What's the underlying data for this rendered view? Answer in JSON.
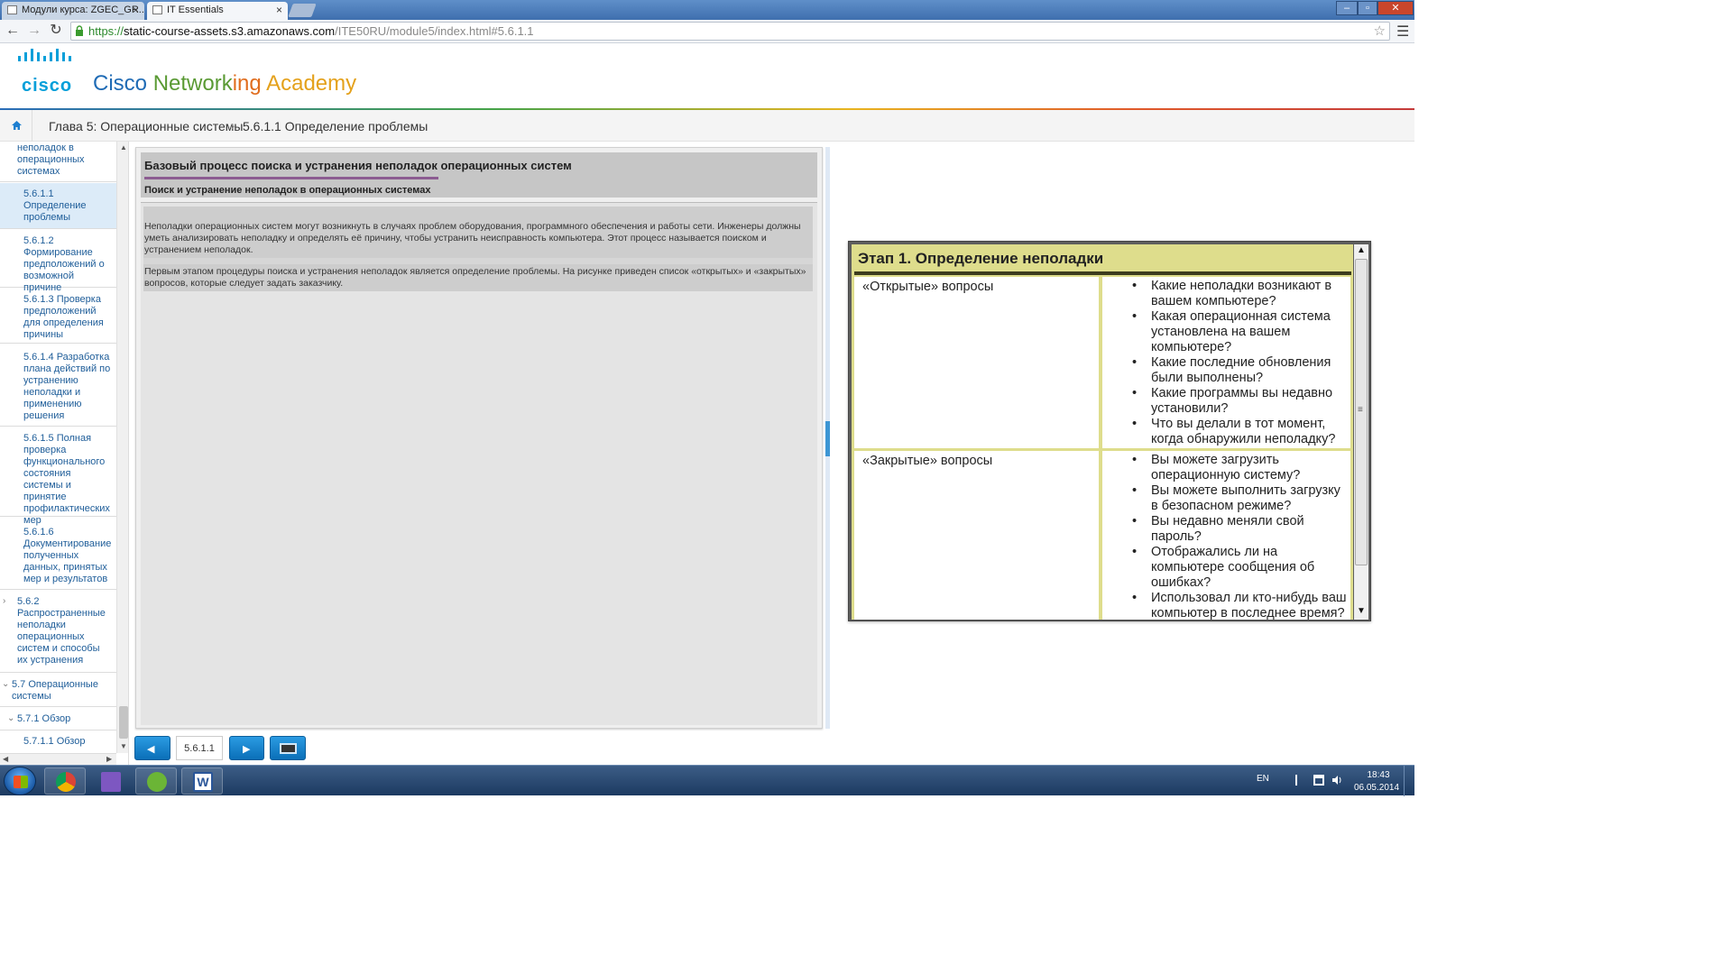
{
  "browser": {
    "tabs": [
      {
        "label": "Модули курса: ZGEC_GR..."
      },
      {
        "label": "IT Essentials"
      }
    ],
    "url_scheme": "https://",
    "url_host": "static-course-assets.s3.amazonaws.com",
    "url_path": "/ITE50RU/module5/index.html#5.6.1.1"
  },
  "header": {
    "logo_text": "cisco",
    "title_word1": "Cisco",
    "title_word2a": "Network",
    "title_word2b": "ing",
    "title_word3": "Academy"
  },
  "breadcrumb": {
    "chapter": "Глава 5: Операционные системы",
    "separator": "›",
    "section": "5.6.1.1 Определение проблемы"
  },
  "sidebar": {
    "items": [
      {
        "label": "неполадок в операционных системах"
      },
      {
        "label": "5.6.1.1 Определение проблемы"
      },
      {
        "label": "5.6.1.2 Формирование предположений о возможной причине"
      },
      {
        "label": "5.6.1.3 Проверка предположений для определения причины"
      },
      {
        "label": "5.6.1.4 Разработка плана действий по устранению неполадки и применению решения"
      },
      {
        "label": "5.6.1.5 Полная проверка функционального состояния системы и принятие профилактических мер"
      },
      {
        "label": "5.6.1.6 Документирование полученных данных, принятых мер и результатов"
      },
      {
        "label": "5.6.2 Распространенные неполадки операционных систем и способы их устранения"
      },
      {
        "label": "5.7 Операционные системы"
      },
      {
        "label": "5.7.1 Обзор"
      },
      {
        "label": "5.7.1.1 Обзор"
      }
    ]
  },
  "content": {
    "title": "Базовый процесс поиска и устранения неполадок операционных систем",
    "subtitle": "Поиск и устранение неполадок в операционных системах",
    "paragraph1": "Неполадки операционных систем могут возникнуть в случаях проблем оборудования, программного обеспечения и работы сети. Инженеры должны уметь анализировать неполадку и определять её причину, чтобы устранить неисправность компьютера. Этот процесс называется поиском и устранением неполадок.",
    "paragraph2": "Первым этапом процедуры поиска и устранения неполадок является определение проблемы. На рисунке приведен список «открытых» и «закрытых» вопросов, которые следует задать заказчику."
  },
  "page_nav": {
    "current_page": "5.6.1.1"
  },
  "figure": {
    "title": "Этап 1. Определение неполадки",
    "bullet": "•",
    "rows": [
      {
        "label": "«Открытые» вопросы",
        "questions": [
          "Какие неполадки возникают в вашем компьютере?",
          "Какая операционная система установлена на вашем компьютере?",
          "Какие последние обновления были выполнены?",
          "Какие программы вы недавно установили?",
          "Что вы делали в тот момент, когда обнаружили неполадку?"
        ]
      },
      {
        "label": "«Закрытые» вопросы",
        "questions": [
          "Вы можете загрузить операционную систему?",
          "Вы можете выполнить загрузку в безопасном режиме?",
          "Вы недавно меняли свой пароль?",
          "Отображались ли на компьютере сообщения об ошибках?",
          "Использовал ли кто-нибудь ваш компьютер в последнее время?"
        ]
      }
    ]
  },
  "taskbar": {
    "word_letter": "W",
    "language": "EN",
    "time": "18:43",
    "date": "06.05.2014"
  },
  "colors": {
    "cisco_blue": "#049fd9",
    "figure_bg": "#dedd8c",
    "nav_button": "#1a86d0",
    "title_underline": "#8c5c91"
  }
}
